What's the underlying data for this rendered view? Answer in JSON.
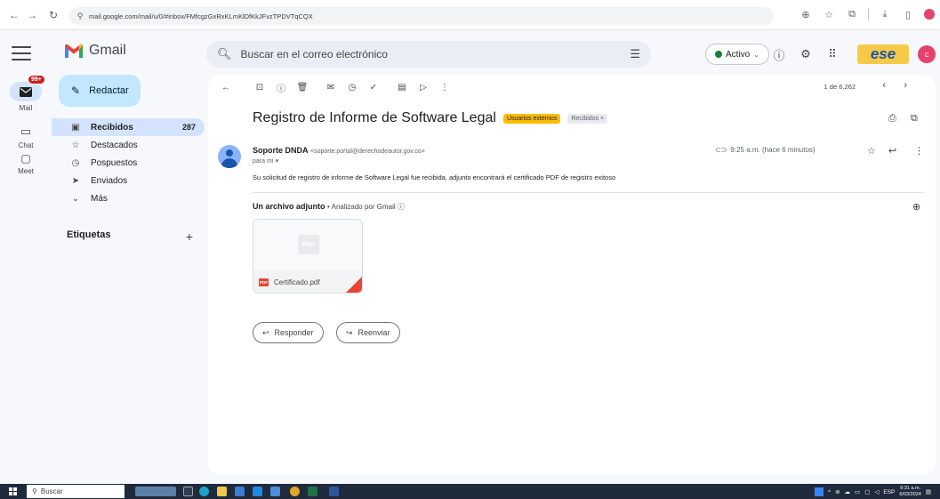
{
  "browser": {
    "url": "mail.google.com/mail/u/0/#inbox/FMfcgzGxRxKLmKlDfKkJFvzTPDVTqCQX",
    "profile_color": "#e5426c"
  },
  "rail": {
    "mail_label": "Mail",
    "mail_badge": "99+",
    "chat_label": "Chat",
    "meet_label": "Meet"
  },
  "header": {
    "app_name": "Gmail",
    "search_placeholder": "Buscar en el correo electrónico",
    "status_label": "Activo",
    "status_color": "#188038",
    "logo_text": "ese",
    "avatar_initial": "c"
  },
  "sidebar": {
    "compose_label": "Redactar",
    "items": [
      {
        "label": "Recibidos",
        "count": "287",
        "icon": "inbox-icon"
      },
      {
        "label": "Destacados",
        "count": "",
        "icon": "star-icon"
      },
      {
        "label": "Pospuestos",
        "count": "",
        "icon": "clock-icon"
      },
      {
        "label": "Enviados",
        "count": "",
        "icon": "send-icon"
      },
      {
        "label": "Más",
        "count": "",
        "icon": "chevron-down-icon"
      }
    ],
    "labels_heading": "Etiquetas",
    "labels_add": "+"
  },
  "toolbar": {
    "pager_text": "1 de 6,262"
  },
  "email": {
    "subject": "Registro de Informe de Software Legal",
    "chip_external": "Usuarios externos",
    "chip_inbox": "Recibidos ×",
    "sender_name": "Soporte DNDA",
    "sender_email": "<soporte.portal@derechodeautor.gov.co>",
    "to_line": "para mí ▾",
    "time": "9:25 a.m. (hace 6 minutos)",
    "body": "Su solicitud de registro de informe de Software Legal fue recibida, adjunto encontrará el certificado PDF de registro exitoso",
    "attachments_heading": "Un archivo adjunto",
    "attachments_scanned": "• Analizado por Gmail ⓘ",
    "attachment_name": "Certificado.pdf",
    "attachment_thumb_text": "PDF",
    "attachment_badge": "PDF",
    "reply_label": "Responder",
    "forward_label": "Reenviar"
  },
  "taskbar": {
    "search_label": "Buscar",
    "lang": "ESP",
    "time": "9:31 a.m.",
    "date": "6/03/2024"
  }
}
